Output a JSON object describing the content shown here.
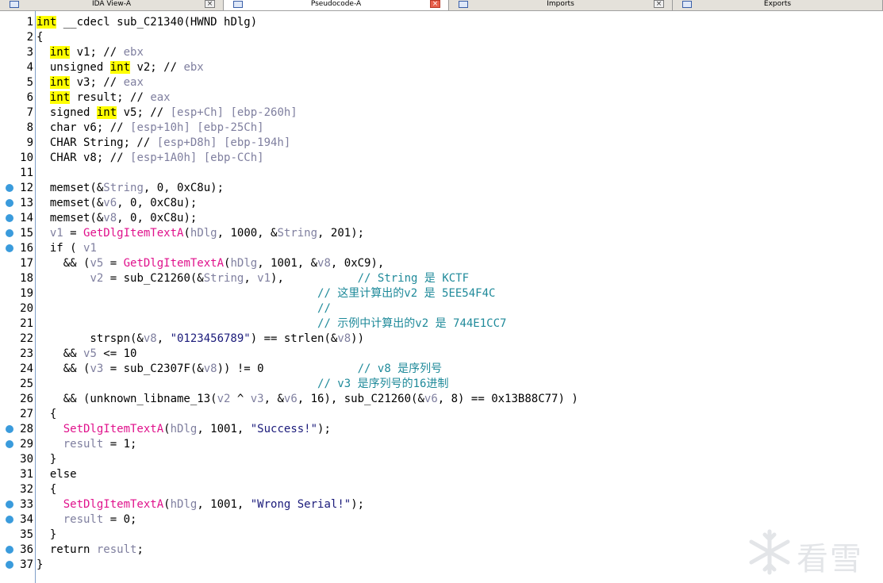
{
  "tabs": [
    {
      "label": "IDA View-A",
      "active": false
    },
    {
      "label": "Pseudocode-A",
      "active": true
    },
    {
      "label": "Imports",
      "active": false
    },
    {
      "label": "Exports",
      "active": false
    }
  ],
  "close_glyph": "×",
  "code_lines": [
    {
      "n": "1",
      "dot": false,
      "segs": [
        [
          "int",
          "kw"
        ],
        [
          " __cdecl sub_C21340(HWND hDlg)",
          ""
        ]
      ]
    },
    {
      "n": "2",
      "dot": false,
      "segs": [
        [
          "{",
          ""
        ]
      ]
    },
    {
      "n": "3",
      "dot": false,
      "segs": [
        [
          "  ",
          ""
        ],
        [
          "int",
          "kw"
        ],
        [
          " v1; // ",
          ""
        ],
        [
          "ebx",
          "gray"
        ]
      ]
    },
    {
      "n": "4",
      "dot": false,
      "segs": [
        [
          "  unsigned ",
          ""
        ],
        [
          "int",
          "kw"
        ],
        [
          " v2; // ",
          ""
        ],
        [
          "ebx",
          "gray"
        ]
      ]
    },
    {
      "n": "5",
      "dot": false,
      "segs": [
        [
          "  ",
          ""
        ],
        [
          "int",
          "kw"
        ],
        [
          " v3; // ",
          ""
        ],
        [
          "eax",
          "gray"
        ]
      ]
    },
    {
      "n": "6",
      "dot": false,
      "segs": [
        [
          "  ",
          ""
        ],
        [
          "int",
          "kw"
        ],
        [
          " result; // ",
          ""
        ],
        [
          "eax",
          "gray"
        ]
      ]
    },
    {
      "n": "7",
      "dot": false,
      "segs": [
        [
          "  signed ",
          ""
        ],
        [
          "int",
          "kw"
        ],
        [
          " v5; // ",
          ""
        ],
        [
          "[esp+Ch] [ebp-260h]",
          "gray"
        ]
      ]
    },
    {
      "n": "8",
      "dot": false,
      "segs": [
        [
          "  char v6; // ",
          ""
        ],
        [
          "[esp+10h] [ebp-25Ch]",
          "gray"
        ]
      ]
    },
    {
      "n": "9",
      "dot": false,
      "segs": [
        [
          "  CHAR String; // ",
          ""
        ],
        [
          "[esp+D8h] [ebp-194h]",
          "gray"
        ]
      ]
    },
    {
      "n": "10",
      "dot": false,
      "segs": [
        [
          "  CHAR v8; // ",
          ""
        ],
        [
          "[esp+1A0h] [ebp-CCh]",
          "gray"
        ]
      ]
    },
    {
      "n": "11",
      "dot": false,
      "segs": [
        [
          "",
          ""
        ]
      ]
    },
    {
      "n": "12",
      "dot": true,
      "segs": [
        [
          "  memset(&",
          ""
        ],
        [
          "String",
          "gray"
        ],
        [
          ", 0, 0xC8u);",
          ""
        ]
      ]
    },
    {
      "n": "13",
      "dot": true,
      "segs": [
        [
          "  memset(&",
          ""
        ],
        [
          "v6",
          "gray"
        ],
        [
          ", 0, 0xC8u);",
          ""
        ]
      ]
    },
    {
      "n": "14",
      "dot": true,
      "segs": [
        [
          "  memset(&",
          ""
        ],
        [
          "v8",
          "gray"
        ],
        [
          ", 0, 0xC8u);",
          ""
        ]
      ]
    },
    {
      "n": "15",
      "dot": true,
      "segs": [
        [
          "  ",
          ""
        ],
        [
          "v1",
          "gray"
        ],
        [
          " = ",
          ""
        ],
        [
          "GetDlgItemTextA",
          "fn"
        ],
        [
          "(",
          ""
        ],
        [
          "hDlg",
          "gray"
        ],
        [
          ", 1000, &",
          ""
        ],
        [
          "String",
          "gray"
        ],
        [
          ", 201);",
          ""
        ]
      ]
    },
    {
      "n": "16",
      "dot": true,
      "segs": [
        [
          "  if ( ",
          ""
        ],
        [
          "v1",
          "gray"
        ]
      ]
    },
    {
      "n": "17",
      "dot": false,
      "segs": [
        [
          "    && (",
          ""
        ],
        [
          "v5",
          "gray"
        ],
        [
          " = ",
          ""
        ],
        [
          "GetDlgItemTextA",
          "fn"
        ],
        [
          "(",
          ""
        ],
        [
          "hDlg",
          "gray"
        ],
        [
          ", 1001, &",
          ""
        ],
        [
          "v8",
          "gray"
        ],
        [
          ", 0xC9),",
          ""
        ]
      ]
    },
    {
      "n": "18",
      "dot": false,
      "segs": [
        [
          "        ",
          ""
        ],
        [
          "v2",
          "gray"
        ],
        [
          " = sub_C21260(&",
          ""
        ],
        [
          "String",
          "gray"
        ],
        [
          ", ",
          ""
        ],
        [
          "v1",
          "gray"
        ],
        [
          "),           ",
          ""
        ],
        [
          "// String 是 KCTF",
          "cm"
        ]
      ]
    },
    {
      "n": "19",
      "dot": false,
      "segs": [
        [
          "                                          ",
          ""
        ],
        [
          "// 这里计算出的v2 是 5EE54F4C",
          "cm"
        ]
      ]
    },
    {
      "n": "20",
      "dot": false,
      "segs": [
        [
          "                                          ",
          ""
        ],
        [
          "//",
          "cm"
        ]
      ]
    },
    {
      "n": "21",
      "dot": false,
      "segs": [
        [
          "                                          ",
          ""
        ],
        [
          "// 示例中计算出的v2 是 744E1CC7",
          "cm"
        ]
      ]
    },
    {
      "n": "22",
      "dot": false,
      "segs": [
        [
          "        strspn(&",
          ""
        ],
        [
          "v8",
          "gray"
        ],
        [
          ", ",
          ""
        ],
        [
          "\"0123456789\"",
          "str"
        ],
        [
          ") == strlen(&",
          ""
        ],
        [
          "v8",
          "gray"
        ],
        [
          "))",
          ""
        ]
      ]
    },
    {
      "n": "23",
      "dot": false,
      "segs": [
        [
          "    && ",
          ""
        ],
        [
          "v5",
          "gray"
        ],
        [
          " <= 10",
          ""
        ]
      ]
    },
    {
      "n": "24",
      "dot": false,
      "segs": [
        [
          "    && (",
          ""
        ],
        [
          "v3",
          "gray"
        ],
        [
          " = sub_C2307F(&",
          ""
        ],
        [
          "v8",
          "gray"
        ],
        [
          ")) != 0              ",
          ""
        ],
        [
          "// v8 是序列号",
          "cm"
        ]
      ]
    },
    {
      "n": "25",
      "dot": false,
      "segs": [
        [
          "                                          ",
          ""
        ],
        [
          "// v3 是序列号的16进制",
          "cm"
        ]
      ]
    },
    {
      "n": "26",
      "dot": false,
      "segs": [
        [
          "    && (unknown_libname_13(",
          ""
        ],
        [
          "v2",
          "gray"
        ],
        [
          " ^ ",
          ""
        ],
        [
          "v3",
          "gray"
        ],
        [
          ", &",
          ""
        ],
        [
          "v6",
          "gray"
        ],
        [
          ", 16), sub_C21260(&",
          ""
        ],
        [
          "v6",
          "gray"
        ],
        [
          ", 8) == 0x13B88C77) )",
          ""
        ]
      ]
    },
    {
      "n": "27",
      "dot": false,
      "segs": [
        [
          "  {",
          ""
        ]
      ]
    },
    {
      "n": "28",
      "dot": true,
      "segs": [
        [
          "    ",
          ""
        ],
        [
          "SetDlgItemTextA",
          "fn"
        ],
        [
          "(",
          ""
        ],
        [
          "hDlg",
          "gray"
        ],
        [
          ", 1001, ",
          ""
        ],
        [
          "\"Success!\"",
          "str"
        ],
        [
          ");",
          ""
        ]
      ]
    },
    {
      "n": "29",
      "dot": true,
      "segs": [
        [
          "    ",
          ""
        ],
        [
          "result",
          "gray"
        ],
        [
          " = 1;",
          ""
        ]
      ]
    },
    {
      "n": "30",
      "dot": false,
      "segs": [
        [
          "  }",
          ""
        ]
      ]
    },
    {
      "n": "31",
      "dot": false,
      "segs": [
        [
          "  else",
          ""
        ]
      ]
    },
    {
      "n": "32",
      "dot": false,
      "segs": [
        [
          "  {",
          ""
        ]
      ]
    },
    {
      "n": "33",
      "dot": true,
      "segs": [
        [
          "    ",
          ""
        ],
        [
          "SetDlgItemTextA",
          "fn"
        ],
        [
          "(",
          ""
        ],
        [
          "hDlg",
          "gray"
        ],
        [
          ", 1001, ",
          ""
        ],
        [
          "\"Wrong Serial!\"",
          "str"
        ],
        [
          ");",
          ""
        ]
      ]
    },
    {
      "n": "34",
      "dot": true,
      "segs": [
        [
          "    ",
          ""
        ],
        [
          "result",
          "gray"
        ],
        [
          " = 0;",
          ""
        ]
      ]
    },
    {
      "n": "35",
      "dot": false,
      "segs": [
        [
          "  }",
          ""
        ]
      ]
    },
    {
      "n": "36",
      "dot": true,
      "segs": [
        [
          "  return ",
          ""
        ],
        [
          "result",
          "gray"
        ],
        [
          ";",
          ""
        ]
      ]
    },
    {
      "n": "37",
      "dot": true,
      "segs": [
        [
          "}",
          ""
        ]
      ]
    }
  ],
  "watermark": {
    "text": "看雪",
    "icon": "snowflake-icon"
  },
  "colors": {
    "keyword_highlight": "#ffff00",
    "function": "#e0128c",
    "variable": "#7f7f9f",
    "comment": "#1f8a9a",
    "breakpoint_dot": "#3a9bdc"
  }
}
